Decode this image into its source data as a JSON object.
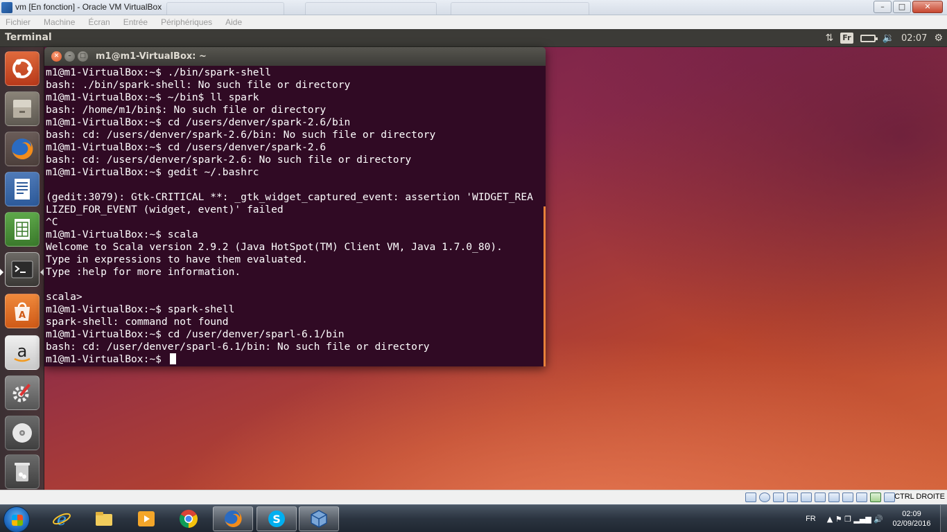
{
  "host_window": {
    "title": "vm [En fonction] - Oracle VM VirtualBox",
    "min_glyph": "–",
    "max_glyph": "□",
    "close_glyph": "✕"
  },
  "vbox_menu": [
    {
      "label": "Fichier"
    },
    {
      "label": "Machine"
    },
    {
      "label": "Écran"
    },
    {
      "label": "Entrée"
    },
    {
      "label": "Périphériques"
    },
    {
      "label": "Aide"
    }
  ],
  "ubuntu_panel": {
    "app_title": "Terminal",
    "network_glyph": "⇅",
    "keyboard_layout": "Fr",
    "volume_glyph": "🔉",
    "clock": "02:07",
    "settings_glyph": "⚙"
  },
  "launcher": {
    "items": [
      "ubuntu-dash",
      "files",
      "firefox",
      "libreoffice-writer",
      "libreoffice-calc",
      "terminal",
      "ubuntu-software-center",
      "amazon",
      "system-settings",
      "dvd",
      "trash"
    ],
    "active": "terminal",
    "accent_color": "#e95420"
  },
  "terminal": {
    "title": "m1@m1-VirtualBox: ~",
    "background": "#300a24",
    "lines": [
      "m1@m1-VirtualBox:~$ ./bin/spark-shell",
      "bash: ./bin/spark-shell: No such file or directory",
      "m1@m1-VirtualBox:~$ ~/bin$ ll spark",
      "bash: /home/m1/bin$: No such file or directory",
      "m1@m1-VirtualBox:~$ cd /users/denver/spark-2.6/bin",
      "bash: cd: /users/denver/spark-2.6/bin: No such file or directory",
      "m1@m1-VirtualBox:~$ cd /users/denver/spark-2.6",
      "bash: cd: /users/denver/spark-2.6: No such file or directory",
      "m1@m1-VirtualBox:~$ gedit ~/.bashrc",
      "",
      "(gedit:3079): Gtk-CRITICAL **: _gtk_widget_captured_event: assertion 'WIDGET_REA",
      "LIZED_FOR_EVENT (widget, event)' failed",
      "^C",
      "m1@m1-VirtualBox:~$ scala",
      "Welcome to Scala version 2.9.2 (Java HotSpot(TM) Client VM, Java 1.7.0_80).",
      "Type in expressions to have them evaluated.",
      "Type :help for more information.",
      "",
      "scala>",
      "m1@m1-VirtualBox:~$ spark-shell",
      "spark-shell: command not found",
      "m1@m1-VirtualBox:~$ cd /user/denver/sparl-6.1/bin",
      "bash: cd: /user/denver/sparl-6.1/bin: No such file or directory",
      "m1@m1-VirtualBox:~$ "
    ]
  },
  "vbox_status": {
    "host_key": "CTRL DROITE",
    "icons": [
      "hard-disk",
      "optical-drive",
      "audio",
      "network",
      "usb",
      "shared-folders",
      "display",
      "video-capture",
      "mouse-integration",
      "cpu",
      "keyboard-capture"
    ]
  },
  "taskbar": {
    "items": [
      "internet-explorer",
      "windows-explorer",
      "media-player",
      "chrome",
      "firefox",
      "skype",
      "virtualbox"
    ],
    "active": "virtualbox",
    "language": "FR",
    "time": "02:09",
    "date": "02/09/2016",
    "tray_glyphs": "▲  ⚑  ❐  ▂▄▆  🔊"
  }
}
